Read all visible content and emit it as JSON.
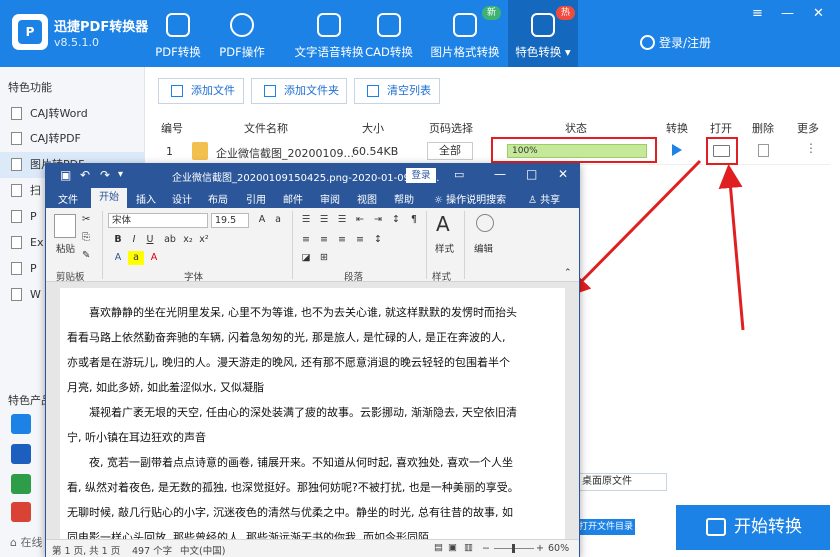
{
  "app": {
    "name": "迅捷PDF转换器",
    "version": "v8.5.1.0"
  },
  "tabs": [
    {
      "label": "PDF转换",
      "icon": "refresh-icon"
    },
    {
      "label": "PDF操作",
      "icon": "gear-icon"
    },
    {
      "label": "文字语音转换",
      "icon": "waveform-icon"
    },
    {
      "label": "CAD转换",
      "icon": "cad-icon"
    },
    {
      "label": "图片格式转换",
      "icon": "image-icon",
      "badge": "新"
    },
    {
      "label": "特色转换",
      "icon": "star-icon",
      "badge": "热"
    }
  ],
  "login": "登录/注册",
  "sidebar": {
    "section1": "特色功能",
    "items": [
      "CAJ转Word",
      "CAJ转PDF",
      "图片转PDF",
      "扫",
      "P",
      "Ex",
      "P",
      "W"
    ],
    "section2": "特色产品",
    "footer": "在线"
  },
  "toolbar": {
    "add_file": "添加文件",
    "add_folder": "添加文件夹",
    "clear_list": "清空列表"
  },
  "table": {
    "headers": [
      "编号",
      "文件名称",
      "大小",
      "页码选择",
      "状态",
      "转换",
      "打开",
      "删除",
      "更多"
    ],
    "row": {
      "index": "1",
      "name": "企业微信截图_20200109...",
      "size": "60.54KB",
      "pages": "全部",
      "progress_pct": 100,
      "progress_label": "100%"
    }
  },
  "bottom": {
    "path_value": "桌面原文件",
    "open_dir": "打开文件目录",
    "start": "开始转换"
  },
  "word": {
    "title": "企业微信截图_20200109150425.png-2020-01-09-15-...",
    "login": "登录",
    "ribbon_tabs": [
      "文件",
      "开始",
      "插入",
      "设计",
      "布局",
      "引用",
      "邮件",
      "审阅",
      "视图",
      "帮助",
      "操作说明搜索",
      "共享"
    ],
    "font_name": "宋体",
    "font_size": "19.5",
    "groups": {
      "clipboard": "剪贴板",
      "font": "字体",
      "paragraph": "段落",
      "styles": "样式",
      "editing": "编辑"
    },
    "paste": "粘贴",
    "styles_btn": "样式",
    "edit_btn": "编辑",
    "paragraphs": [
      "喜欢静静的坐在光阴里发呆, 心里不为等谁, 也不为去关心谁, 就这样默默的发愣时而抬头看看马路上依然勤奋奔驰的车辆, 闪着急匆匆的光, 那是旅人, 是忙碌的人, 是正在奔波的人, 亦或者是在游玩儿, 晚归的人。漫天游走的晚风, 还有那不愿意消退的晚云轻轻的包围着半个月亮, 如此多娇, 如此羞涩似水, 又似凝脂",
      "凝视着广袤无垠的天空, 任由心的深处装满了疲的故事。云影挪动, 渐渐隐去, 天空依旧清宁, 听小镇在耳边狂欢的声音",
      "夜, 宽若一副带着点点诗意的画卷, 铺展开来。不知道从何时起, 喜欢独处, 喜欢一个人坐看, 纵然对着夜色, 是无数的孤独, 也深觉挺好。那独何妨呢?不被打扰, 也是一种美丽的享受。无聊时候, 敲几行贴心的小字, 沉迷夜色的清然与优柔之中。静坐的时光, 总有往昔的故事, 如同电影一样心头回放, 那些曾经的人, 那些渐远渐无书的你我, 而如今形同陌"
    ],
    "status": {
      "page": "第 1 页, 共 1 页",
      "words": "497 个字",
      "lang": "中文(中国)",
      "zoom": "60%"
    }
  },
  "colors": {
    "brand": "#1d82e6",
    "word": "#2b579a",
    "highlight": "#e02020"
  }
}
